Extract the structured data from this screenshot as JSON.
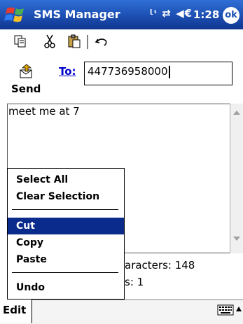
{
  "titlebar": {
    "app_title": "SMS Manager",
    "status_icons": "ᶩᶥ ⇄ ◀€",
    "time": "1:28",
    "ok_label": "ok"
  },
  "toolbar": {
    "icons": [
      "copy-icon",
      "cut-icon",
      "paste-icon",
      "undo-icon"
    ]
  },
  "compose": {
    "send_label": "Send",
    "to_label": "To:",
    "to_value": "447736958000",
    "message": "meet me at 7",
    "characters_text": "aracters: 148",
    "parts_text": "s: 1"
  },
  "context_menu": {
    "items": [
      "Select All",
      "Clear Selection",
      "Cut",
      "Copy",
      "Paste",
      "Undo"
    ],
    "selected": "Cut"
  },
  "bottom": {
    "edit_label": "Edit"
  },
  "colors": {
    "titlebar": "#1d4fb2",
    "selection": "#0a2b8c",
    "link": "#0000cc"
  }
}
